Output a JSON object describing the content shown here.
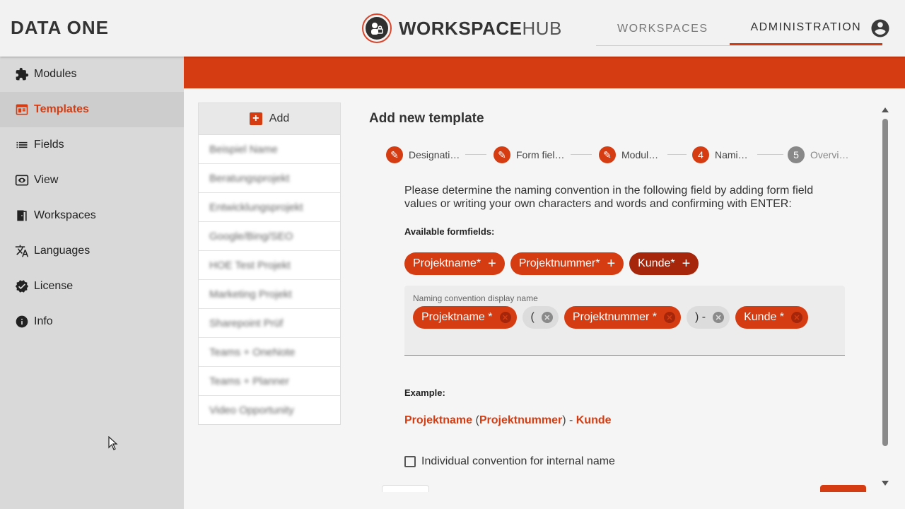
{
  "header": {
    "brand": "DATA ONE",
    "product_bold": "WORKSPACE",
    "product_thin": "HUB",
    "nav": [
      {
        "label": "WORKSPACES",
        "active": false
      },
      {
        "label": "ADMINISTRATION",
        "active": true
      }
    ],
    "account_icon": "account-circle-icon"
  },
  "sidebar": {
    "items": [
      {
        "label": "Modules",
        "icon": "puzzle-icon",
        "active": false
      },
      {
        "label": "Templates",
        "icon": "template-icon",
        "active": true
      },
      {
        "label": "Fields",
        "icon": "list-icon",
        "active": false
      },
      {
        "label": "View",
        "icon": "eye-icon",
        "active": false
      },
      {
        "label": "Workspaces",
        "icon": "door-icon",
        "active": false
      },
      {
        "label": "Languages",
        "icon": "translate-icon",
        "active": false
      },
      {
        "label": "License",
        "icon": "verified-icon",
        "active": false
      },
      {
        "label": "Info",
        "icon": "info-icon",
        "active": false
      }
    ]
  },
  "templates": {
    "add_label": "Add",
    "items": [
      "Beispiel Name",
      "Beratungsprojekt",
      "Entwicklungsprojekt",
      "Google/Bing/SEO",
      "HOE Test Projekt",
      "Marketing Projekt",
      "Sharepoint Prüf",
      "Teams + OneNote",
      "Teams + Planner",
      "Video Opportunity"
    ]
  },
  "form": {
    "title": "Add new template",
    "steps": [
      {
        "label": "Designati…",
        "marker": "✎",
        "state": "done"
      },
      {
        "label": "Form fiel…",
        "marker": "✎",
        "state": "done"
      },
      {
        "label": "Modul…",
        "marker": "✎",
        "state": "done"
      },
      {
        "label": "Nami…",
        "marker": "4",
        "state": "active"
      },
      {
        "label": "Overvi…",
        "marker": "5",
        "state": "pending"
      }
    ],
    "instruction": "Please determine the naming convention in the following field by adding form field values or writing your own characters and words and confirming with ENTER:",
    "available_label": "Available formfields:",
    "available_fields": [
      "Projektname*",
      "Projektnummer*",
      "Kunde*"
    ],
    "naming_field_label": "Naming convention display name",
    "tokens": [
      {
        "text": "Projektname *",
        "kind": "field"
      },
      {
        "text": "(",
        "kind": "text"
      },
      {
        "text": "Projektnummer *",
        "kind": "field"
      },
      {
        "text": ") -",
        "kind": "text"
      },
      {
        "text": "Kunde *",
        "kind": "field"
      }
    ],
    "example_label": "Example:",
    "example": {
      "part1": "Projektname",
      "sep1": " (",
      "part2": "Projektnummer",
      "sep2": ") - ",
      "part3": "Kunde"
    },
    "checkbox_label": "Individual convention for internal name",
    "checkbox_checked": false
  },
  "colors": {
    "accent": "#d63c12",
    "accent_dark": "#a5260a",
    "sidebar_bg": "#d9d9d9"
  }
}
